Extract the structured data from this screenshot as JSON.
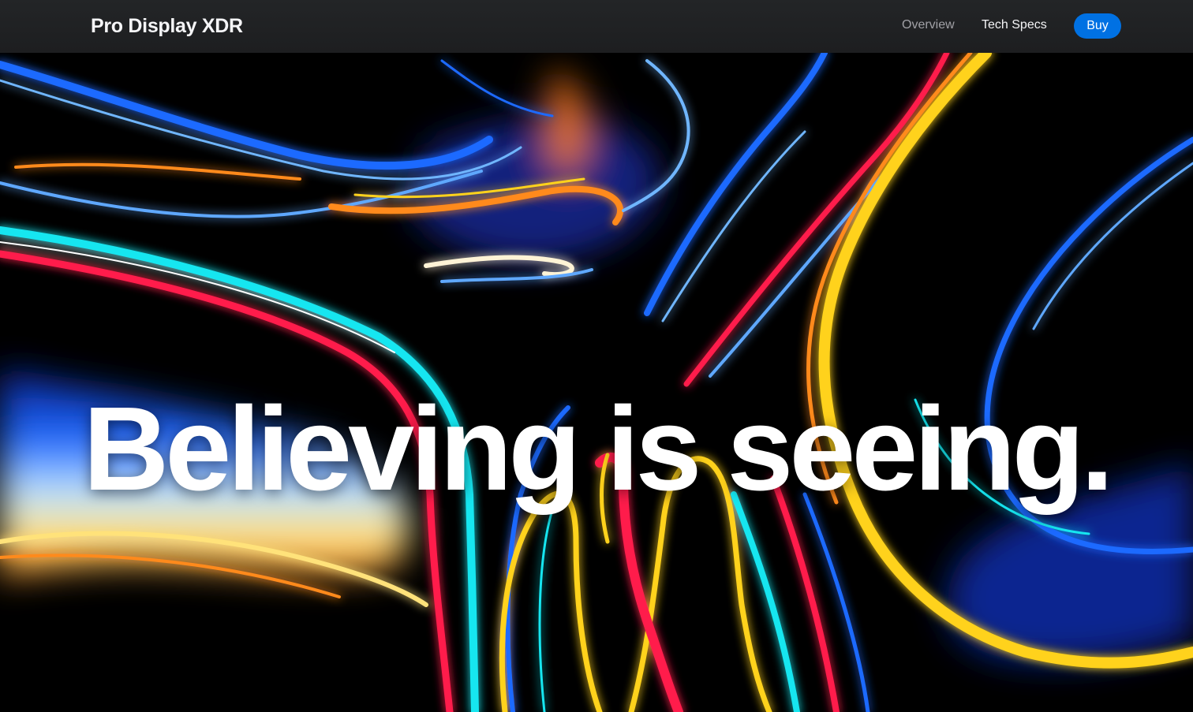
{
  "nav": {
    "brand": "Pro Display XDR",
    "links": [
      {
        "label": "Overview",
        "active": false
      },
      {
        "label": "Tech Specs",
        "active": true
      }
    ],
    "buy_label": "Buy"
  },
  "hero": {
    "headline": "Believing is seeing.",
    "background": "abstract-neon-swirl-art"
  },
  "colors": {
    "nav_background": "#1d1e20",
    "accent": "#0071e3",
    "nav_link_inactive": "#a1a1a6",
    "nav_link_active": "#f5f5f7",
    "hero_background": "#000000",
    "swirl_blue": "#1e6bff",
    "swirl_cyan": "#16e6f0",
    "swirl_red": "#ff1f4b",
    "swirl_yellow": "#ffd21a",
    "swirl_orange": "#ff8a1a"
  }
}
